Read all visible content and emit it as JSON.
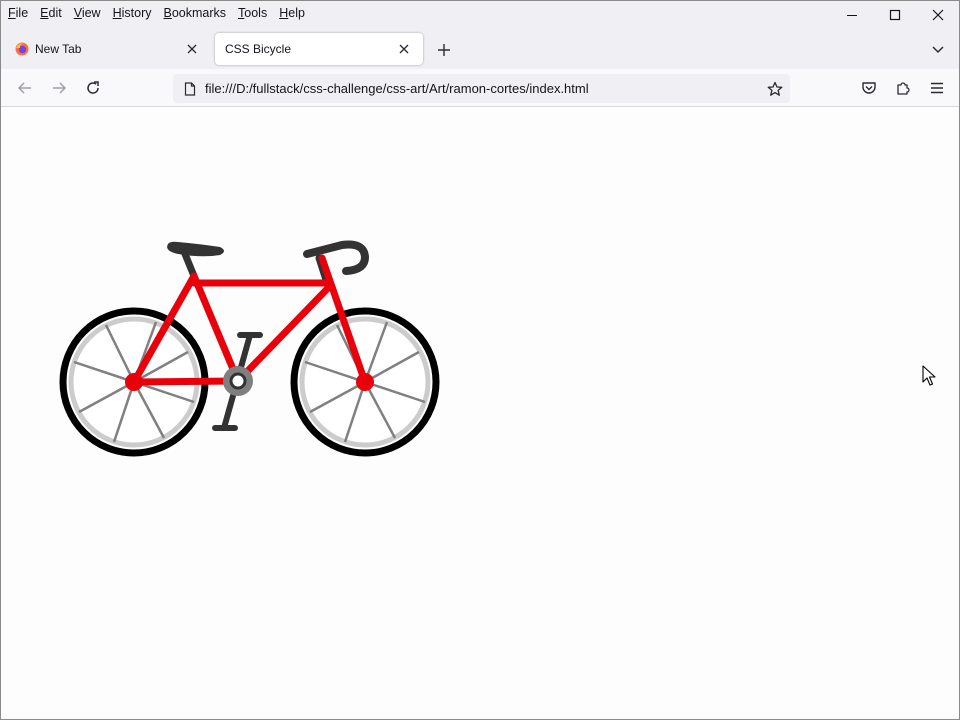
{
  "menubar": {
    "items": [
      {
        "first": "F",
        "rest": "ile"
      },
      {
        "first": "E",
        "rest": "dit"
      },
      {
        "first": "V",
        "rest": "iew"
      },
      {
        "first": "H",
        "rest": "istory"
      },
      {
        "first": "B",
        "rest": "ookmarks"
      },
      {
        "first": "T",
        "rest": "ools"
      },
      {
        "first": "H",
        "rest": "elp"
      }
    ]
  },
  "tabs": [
    {
      "label": "New Tab",
      "icon": "firefox-icon",
      "active": false
    },
    {
      "label": "CSS Bicycle",
      "active": true
    }
  ],
  "navbar": {
    "url": "file:///D:/fullstack/css-challenge/css-art/Art/ramon-cortes/index.html"
  },
  "colors": {
    "frame": "#e8000b",
    "tire": "#000000",
    "rim": "#cccccc",
    "spoke": "#808080",
    "parts": "#333333",
    "crank_ring": "#7f7f7f"
  }
}
